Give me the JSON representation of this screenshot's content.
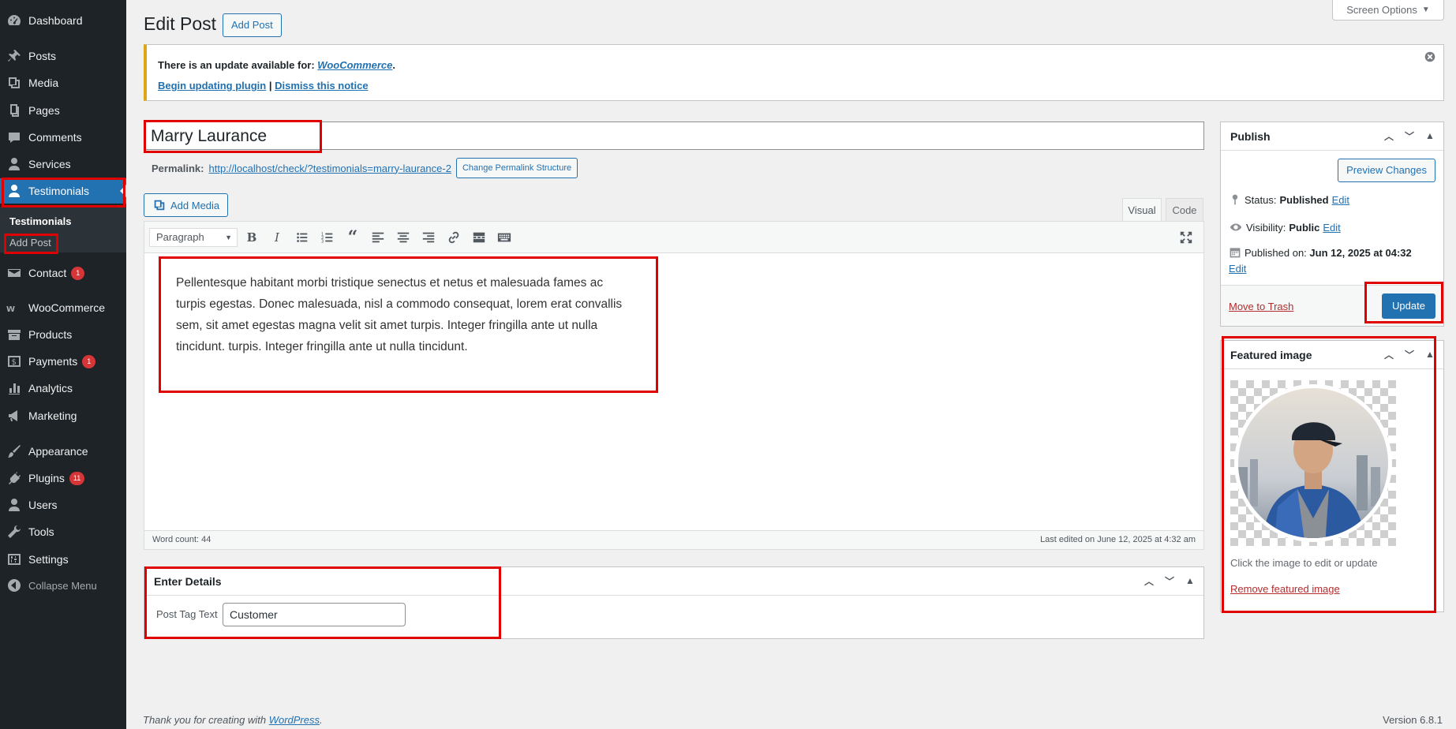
{
  "sidebar": {
    "items": [
      {
        "label": "Dashboard",
        "icon": "dashboard-icon"
      },
      {
        "label": "Posts",
        "icon": "pin-icon"
      },
      {
        "label": "Media",
        "icon": "media-icon"
      },
      {
        "label": "Pages",
        "icon": "pages-icon"
      },
      {
        "label": "Comments",
        "icon": "comment-icon"
      },
      {
        "label": "Services",
        "icon": "user-icon"
      },
      {
        "label": "Testimonials",
        "icon": "user-icon"
      },
      {
        "label": "Contact",
        "icon": "envelope-icon",
        "badge": "1"
      },
      {
        "label": "WooCommerce",
        "icon": "woo-icon"
      },
      {
        "label": "Products",
        "icon": "archive-icon"
      },
      {
        "label": "Payments",
        "icon": "dollar-icon",
        "badge": "1"
      },
      {
        "label": "Analytics",
        "icon": "bar-chart-icon"
      },
      {
        "label": "Marketing",
        "icon": "megaphone-icon"
      },
      {
        "label": "Appearance",
        "icon": "brush-icon"
      },
      {
        "label": "Plugins",
        "icon": "plug-icon",
        "badge": "11"
      },
      {
        "label": "Users",
        "icon": "user-icon"
      },
      {
        "label": "Tools",
        "icon": "wrench-icon"
      },
      {
        "label": "Settings",
        "icon": "sliders-icon"
      },
      {
        "label": "Collapse Menu",
        "icon": "collapse-icon"
      }
    ],
    "submenu": {
      "title": "Testimonials",
      "add": "Add Post"
    }
  },
  "header": {
    "title": "Edit Post",
    "add_button": "Add Post",
    "screen_options": "Screen Options"
  },
  "notice": {
    "text": "There is an update available for: ",
    "plugin": "WooCommerce",
    "period": ".",
    "begin": "Begin updating plugin",
    "sep": "|",
    "dismiss": "Dismiss this notice"
  },
  "post": {
    "title": "Marry Laurance",
    "permalink_label": "Permalink:",
    "permalink_url": "http://localhost/check/?testimonials=marry-laurance-2",
    "change_permalink": "Change Permalink Structure"
  },
  "editor": {
    "add_media": "Add Media",
    "tab_visual": "Visual",
    "tab_code": "Code",
    "format": "Paragraph",
    "content": "Pellentesque habitant morbi tristique senectus et netus et malesuada fames ac turpis egestas. Donec malesuada, nisl a commodo consequat, lorem erat convallis sem, sit amet egestas magna velit sit amet turpis. Integer fringilla ante ut nulla tincidunt. turpis. Integer fringilla ante ut nulla tincidunt.",
    "word_count": "Word count: 44",
    "last_edited": "Last edited on June 12, 2025 at 4:32 am"
  },
  "details": {
    "title": "Enter Details",
    "label": "Post Tag Text",
    "value": "Customer"
  },
  "publish": {
    "title": "Publish",
    "preview": "Preview Changes",
    "status_label": "Status: ",
    "status_value": "Published",
    "visibility_label": "Visibility: ",
    "visibility_value": "Public",
    "published_label": "Published on: ",
    "published_value": "Jun 12, 2025 at 04:32",
    "edit": "Edit",
    "trash": "Move to Trash",
    "update": "Update"
  },
  "featured": {
    "title": "Featured image",
    "hint": "Click the image to edit or update",
    "remove": "Remove featured image"
  },
  "footer": {
    "thanks": "Thank you for creating with ",
    "wp": "WordPress",
    "period": ".",
    "version": "Version 6.8.1"
  },
  "colors": {
    "accent": "#2271b1",
    "sidebar": "#1d2327",
    "annotation": "#e00000",
    "notice_border": "#dba617"
  }
}
